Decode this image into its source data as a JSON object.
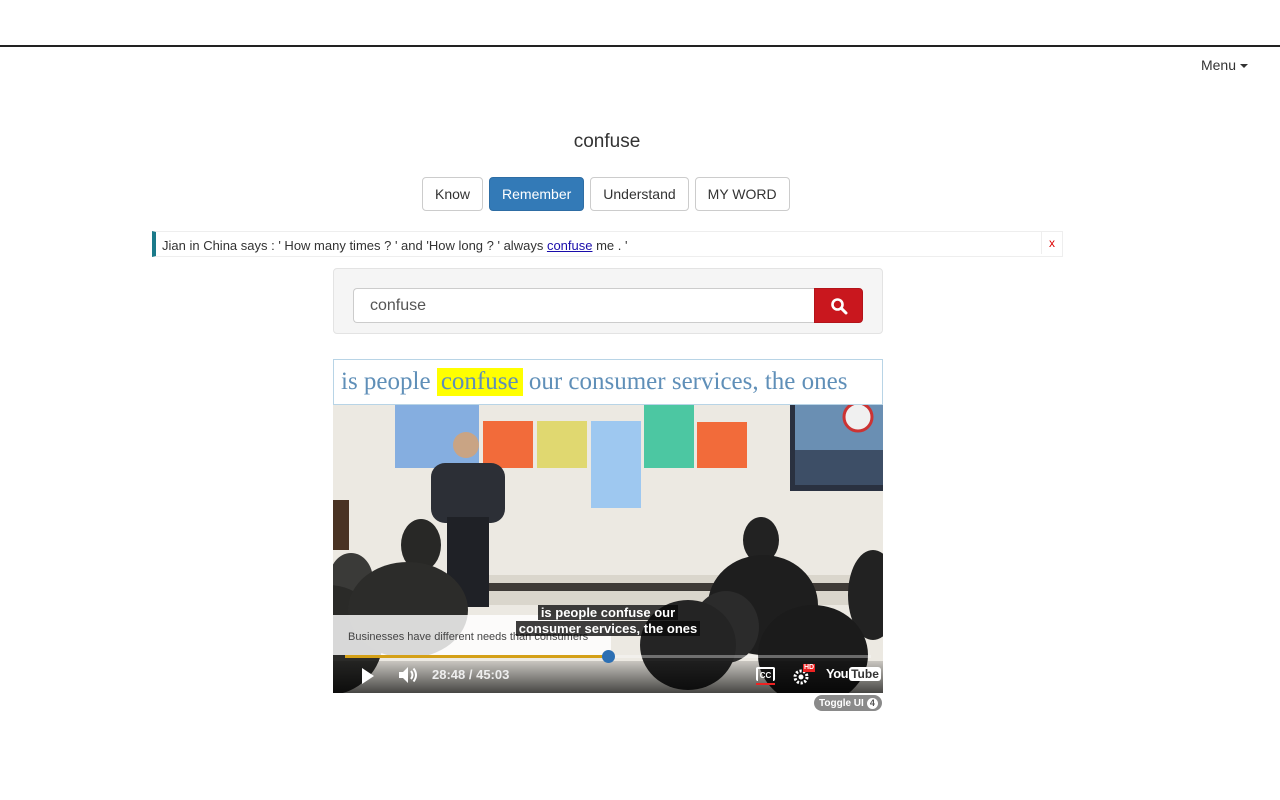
{
  "header": {
    "menu_label": "Menu"
  },
  "word": "confuse",
  "mode_buttons": [
    {
      "label": "Know",
      "active": false
    },
    {
      "label": "Remember",
      "active": true
    },
    {
      "label": "Understand",
      "active": false
    },
    {
      "label": "MY WORD",
      "active": false
    }
  ],
  "quote": {
    "prefix": "Jian in China says : ' How many times ? ' and 'How long ? ' always ",
    "link_word": "confuse",
    "suffix": " me . '",
    "close_label": "x"
  },
  "search": {
    "value": "confuse",
    "icon": "search-icon"
  },
  "caption": {
    "before": "is people ",
    "highlight": "confuse",
    "after": " our consumer services, the ones"
  },
  "video": {
    "subtitle_line1": "is people confuse our",
    "subtitle_line2": "consumer services, the ones",
    "ticker_text": "Businesses have different needs than consumers",
    "time_display": "28:48 / 45:03",
    "progress_fraction": 0.5,
    "cc_label": "CC",
    "hd_badge": "HD",
    "youtube_label": "YouTube"
  },
  "toggle_ui": {
    "label": "Toggle UI",
    "count": "4"
  },
  "colors": {
    "primary": "#337ab7",
    "search_button": "#c9171e",
    "caption_text": "#5f8fb8",
    "highlight": "#ffff00",
    "quote_border": "#1a7a8a"
  }
}
